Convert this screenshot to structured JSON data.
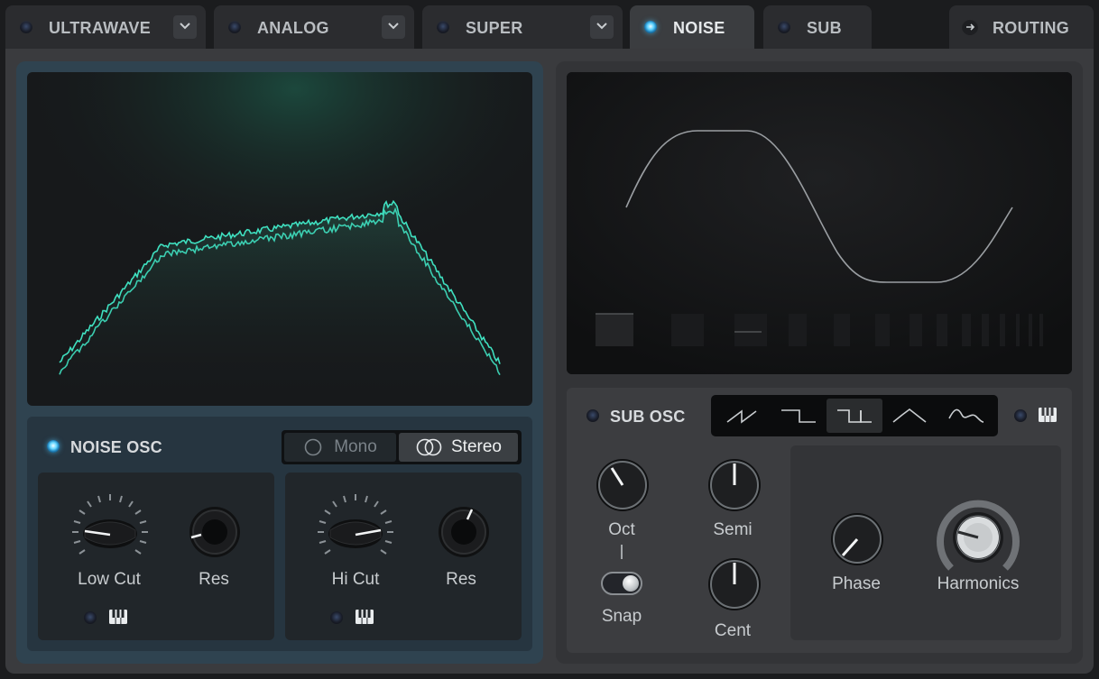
{
  "tabs": [
    {
      "label": "ULTRAWAVE",
      "led_on": false,
      "has_dropdown": true
    },
    {
      "label": "ANALOG",
      "led_on": false,
      "has_dropdown": true
    },
    {
      "label": "SUPER",
      "led_on": false,
      "has_dropdown": true
    },
    {
      "label": "NOISE",
      "led_on": true,
      "has_dropdown": false,
      "active": true
    },
    {
      "label": "SUB",
      "led_on": false,
      "has_dropdown": false
    },
    {
      "label": "ROUTING",
      "icon": "arrow-right-icon"
    }
  ],
  "noise": {
    "title": "NOISE OSC",
    "enabled": true,
    "mode": {
      "options": [
        "Mono",
        "Stereo"
      ],
      "selected": "Stereo"
    },
    "low": {
      "cut_label": "Low Cut",
      "res_label": "Res"
    },
    "high": {
      "cut_label": "Hi Cut",
      "res_label": "Res"
    },
    "accent_color": "#3fe0c0"
  },
  "sub": {
    "title": "SUB OSC",
    "enabled": false,
    "waveforms": [
      "saw",
      "pulse",
      "square",
      "triangle",
      "custom"
    ],
    "selected_waveform": "square",
    "knobs": {
      "oct": "Oct",
      "semi": "Semi",
      "cent": "Cent",
      "phase": "Phase",
      "harmonics": "Harmonics"
    },
    "snap": {
      "label": "Snap",
      "on": true
    }
  }
}
